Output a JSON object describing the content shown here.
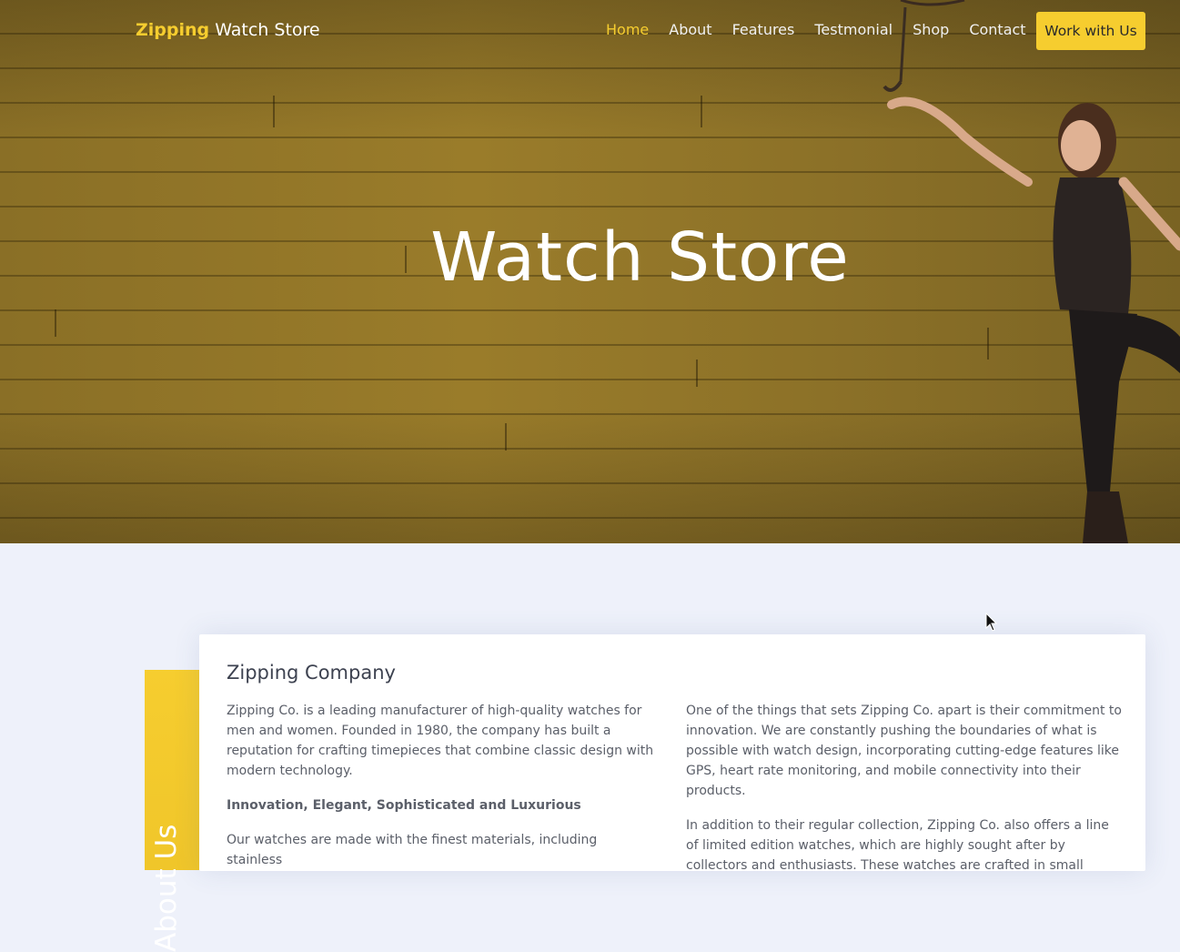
{
  "brand": {
    "accent": "Zipping",
    "rest": "Watch Store"
  },
  "nav": {
    "items": [
      {
        "label": "Home",
        "active": true
      },
      {
        "label": "About"
      },
      {
        "label": "Features"
      },
      {
        "label": "Testmonial"
      },
      {
        "label": "Shop"
      },
      {
        "label": "Contact"
      }
    ],
    "cta_label": "Work with Us"
  },
  "hero": {
    "title": "Watch Store"
  },
  "about": {
    "tab_label": "About Us",
    "heading": "Zipping Company",
    "left": {
      "p1": "Zipping Co. is a leading manufacturer of high-quality watches for men and women. Founded in 1980, the company has built a reputation for crafting timepieces that combine classic design with modern technology.",
      "tagline": "Innovation, Elegant, Sophisticated and Luxurious",
      "p2": "Our watches are made with the finest materials, including stainless"
    },
    "right": {
      "p1": "One of the things that sets Zipping Co. apart is their commitment to innovation. We are constantly pushing the boundaries of what is possible with watch design, incorporating cutting-edge features like GPS, heart rate monitoring, and mobile connectivity into their products.",
      "p2": "In addition to their regular collection, Zipping Co. also offers a line of limited edition watches, which are highly sought after by collectors and enthusiasts. These watches are crafted in small quantities and feature"
    }
  },
  "colors": {
    "accent": "#f6cd2f",
    "hero_overlay": "#8a6f26",
    "section_bg": "#eef1fa"
  }
}
